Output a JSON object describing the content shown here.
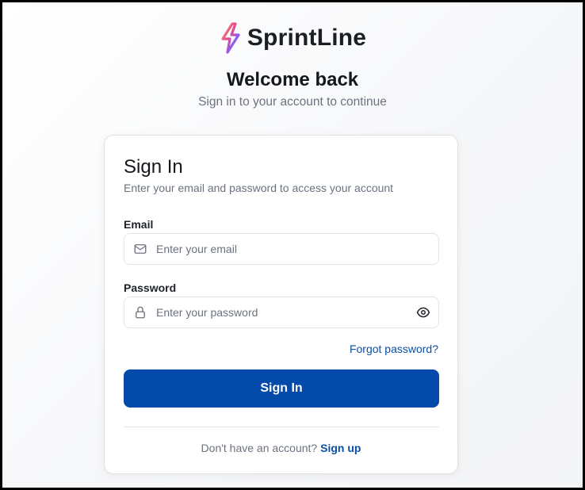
{
  "brand": {
    "name": "SprintLine",
    "logo_icon": "lightning-bolt-icon",
    "logo_colors": [
      "#f5a35c",
      "#e84a8a",
      "#8b5cf6",
      "#4f7ff0"
    ]
  },
  "welcome": {
    "title": "Welcome back",
    "subtitle": "Sign in to your account to continue"
  },
  "card": {
    "title": "Sign In",
    "description": "Enter your email and password to access your account"
  },
  "form": {
    "email": {
      "label": "Email",
      "placeholder": "Enter your email",
      "value": "",
      "icon": "mail-icon"
    },
    "password": {
      "label": "Password",
      "placeholder": "Enter your password",
      "value": "",
      "icon": "lock-icon",
      "toggle_icon": "eye-icon"
    },
    "forgot_link": "Forgot password?",
    "submit_label": "Sign In"
  },
  "footer": {
    "prompt": "Don't have an account?",
    "signup_link": "Sign up"
  },
  "colors": {
    "primary": "#034aaa",
    "link": "#0a4fa6",
    "muted_text": "#6b7280"
  }
}
